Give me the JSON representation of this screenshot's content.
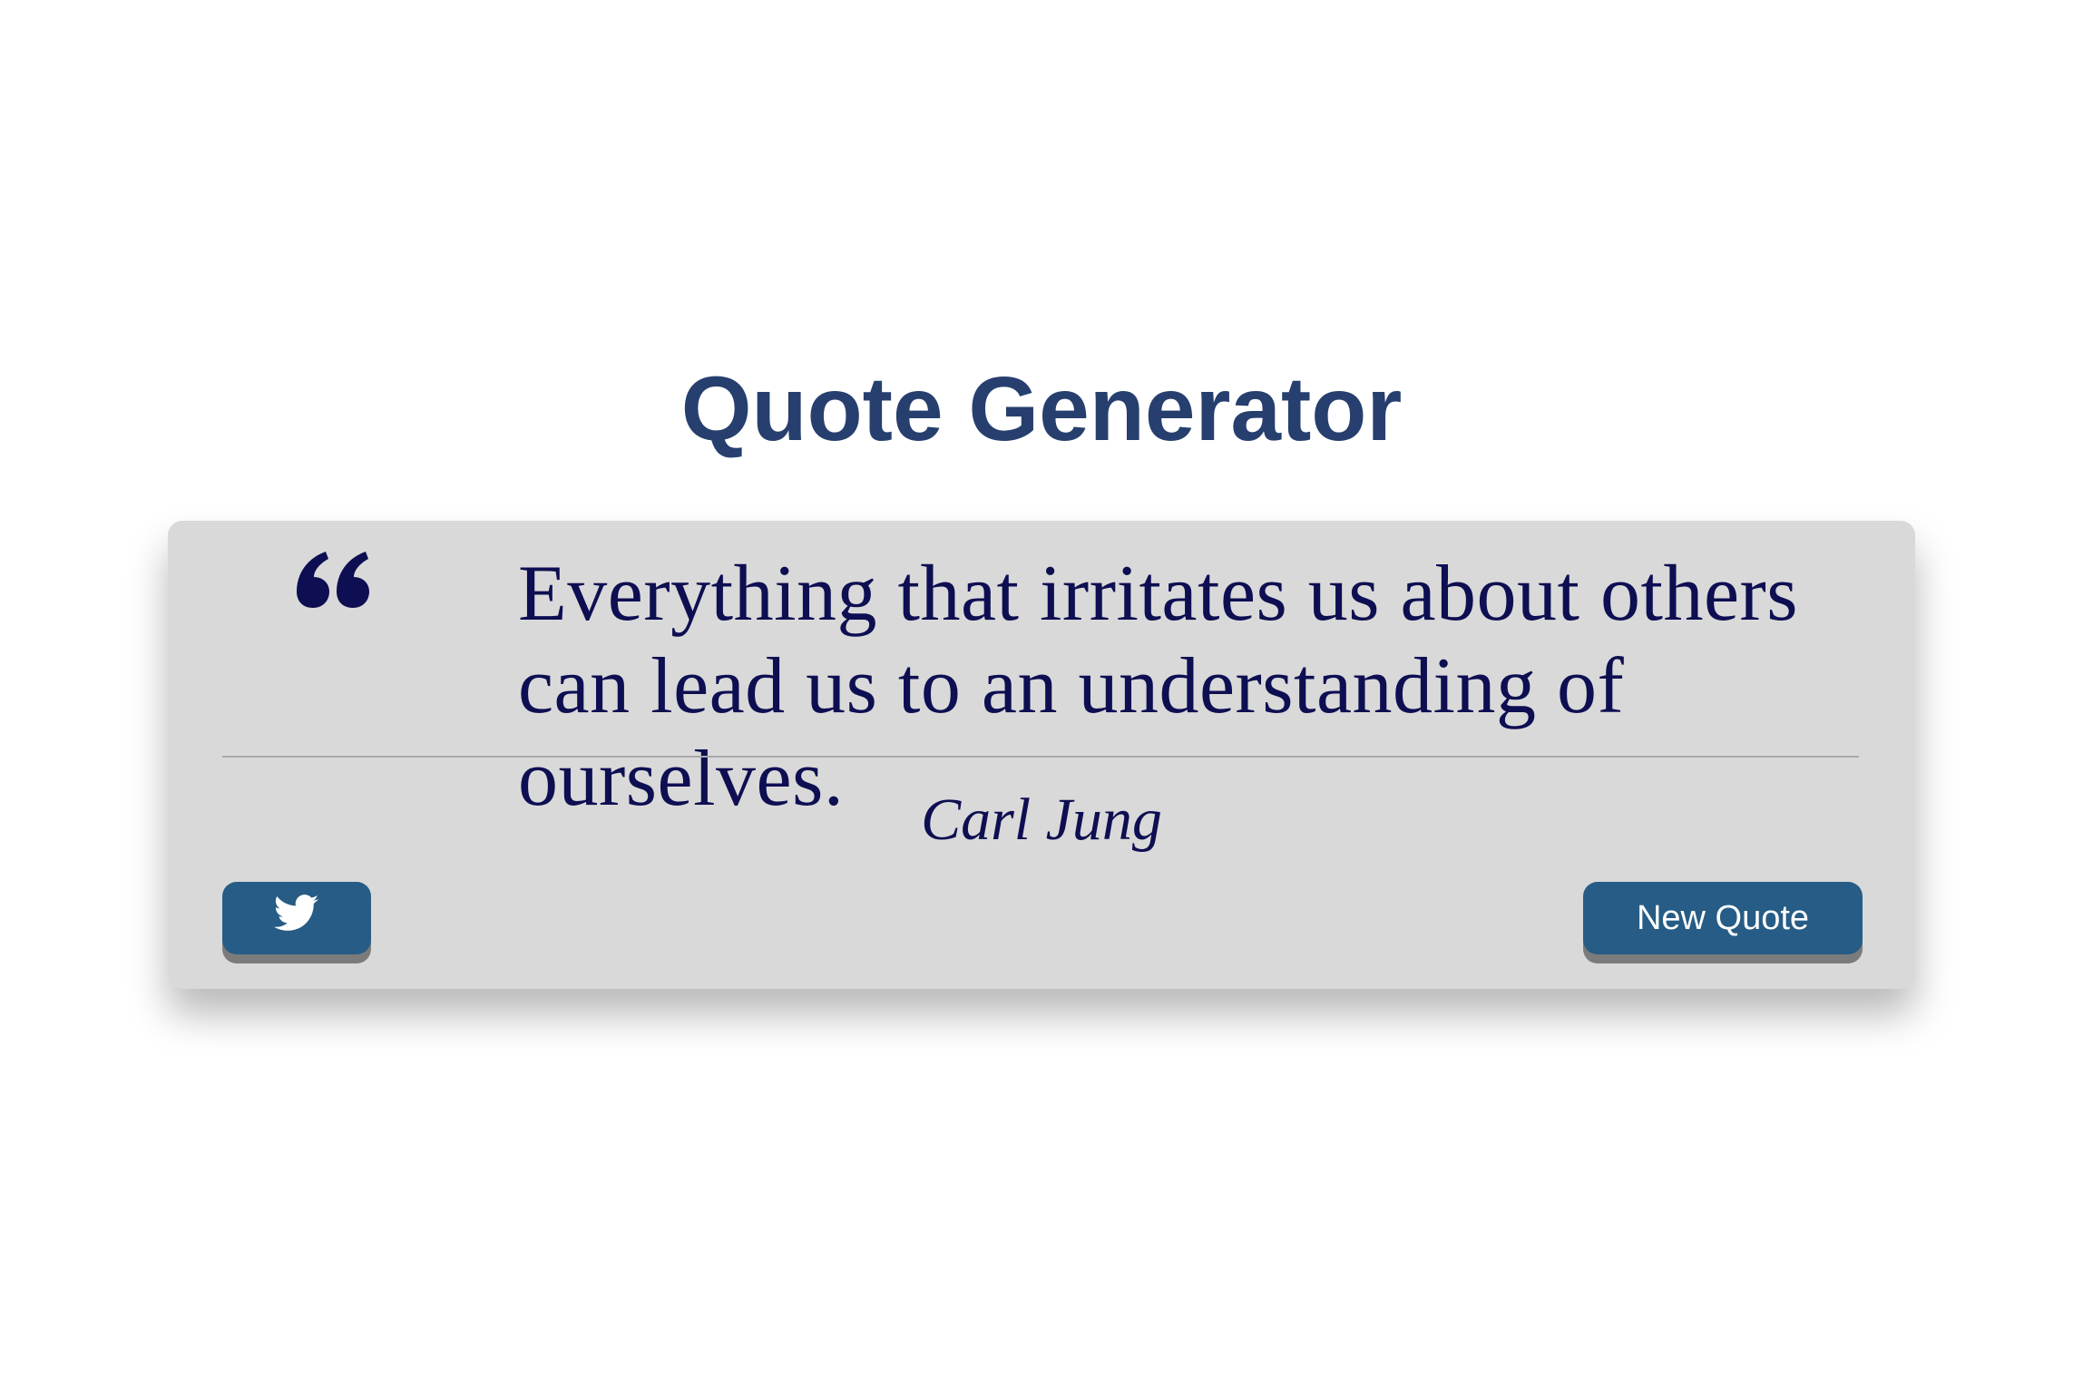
{
  "page": {
    "title": "Quote Generator"
  },
  "quote": {
    "text": "Everything that irritates us about others can lead us to an understanding of ourselves.",
    "author": "Carl Jung",
    "icon": "quote-left-icon"
  },
  "actions": {
    "tweet_icon": "twitter-icon",
    "new_quote_label": "New Quote"
  },
  "colors": {
    "title": "#263f6e",
    "text": "#0e0e52",
    "card_background": "#d9d9d9",
    "button_background": "#265c85",
    "button_text": "#ffffff"
  }
}
